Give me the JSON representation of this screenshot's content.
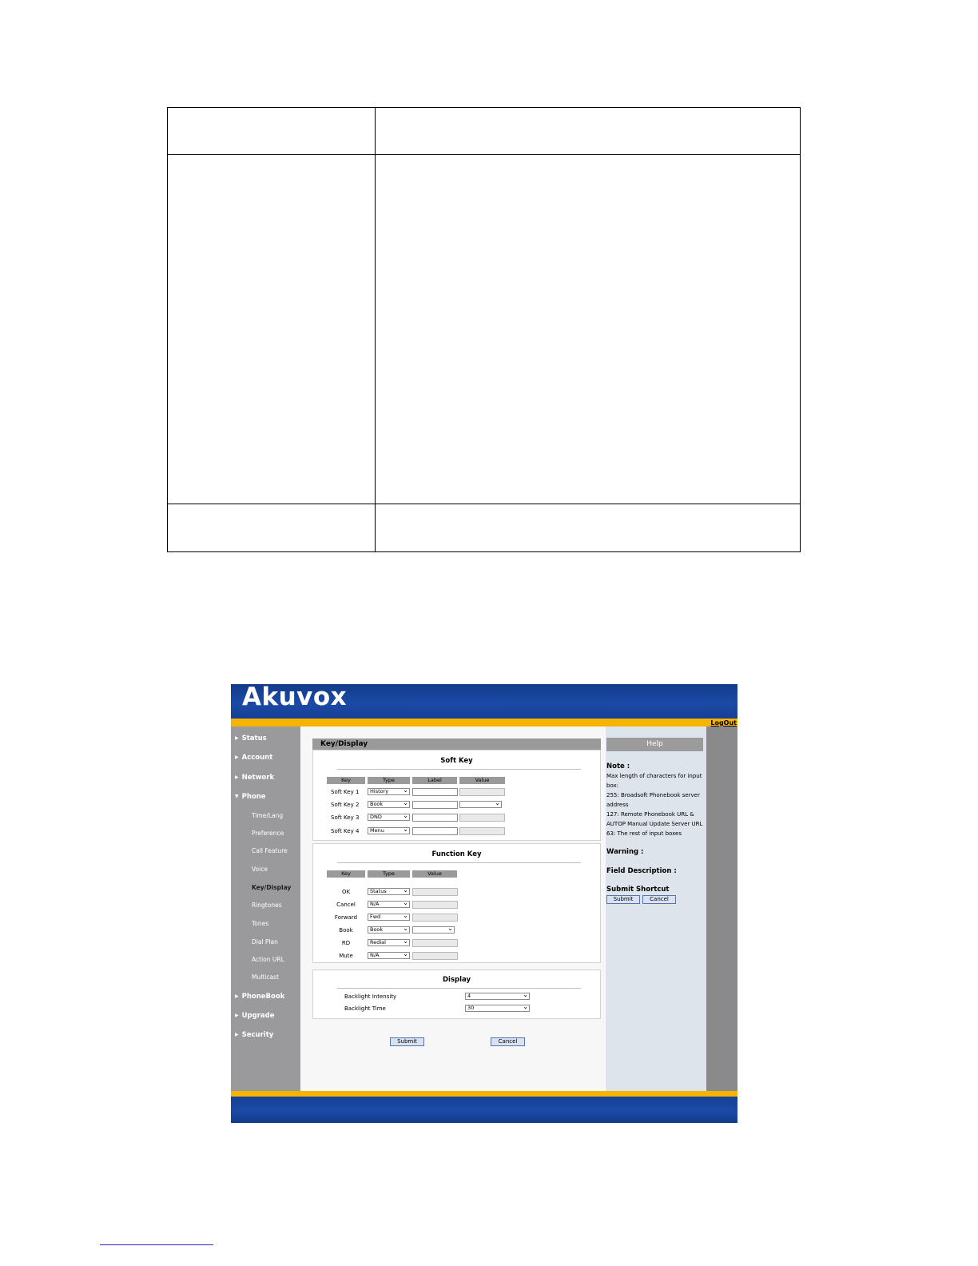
{
  "app": {
    "logo": "Akuvox",
    "logout": "LogOut"
  },
  "sidebar": {
    "items": [
      {
        "label": "Status"
      },
      {
        "label": "Account"
      },
      {
        "label": "Network"
      },
      {
        "label": "Phone"
      },
      {
        "label": "PhoneBook"
      },
      {
        "label": "Upgrade"
      },
      {
        "label": "Security"
      }
    ],
    "phone_sub": [
      "Time/Lang",
      "Preference",
      "Call Feature",
      "Voice",
      "Key/Display",
      "Ringtones",
      "Tones",
      "Dial Plan",
      "Action URL",
      "Multicast"
    ],
    "active": "Key/Display"
  },
  "main": {
    "title": "Key/Display",
    "soft_key": {
      "title": "Soft Key",
      "headers": [
        "Key",
        "Type",
        "Label",
        "Value"
      ],
      "rows": [
        {
          "key": "Soft Key 1",
          "type": "History"
        },
        {
          "key": "Soft Key 2",
          "type": "Book"
        },
        {
          "key": "Soft Key 3",
          "type": "DND"
        },
        {
          "key": "Soft Key 4",
          "type": "Menu"
        }
      ]
    },
    "function_key": {
      "title": "Function Key",
      "headers": [
        "Key",
        "Type",
        "Value"
      ],
      "rows": [
        {
          "key": "OK",
          "type": "Status"
        },
        {
          "key": "Cancel",
          "type": "N/A"
        },
        {
          "key": "Forward",
          "type": "Fwd"
        },
        {
          "key": "Book",
          "type": "Book"
        },
        {
          "key": "RD",
          "type": "Redial"
        },
        {
          "key": "Mute",
          "type": "N/A"
        }
      ]
    },
    "display": {
      "title": "Display",
      "rows": [
        {
          "label": "Backlight Intensity",
          "value": "4"
        },
        {
          "label": "Backlight Time",
          "value": "30"
        }
      ]
    },
    "submit": "Submit",
    "cancel": "Cancel"
  },
  "help": {
    "title": "Help",
    "note_label": "Note :",
    "note_lines": [
      "Max length of characters for input",
      "box:",
      "255: Broadsoft Phonebook server",
      "address",
      "127: Remote Phonebook URL &",
      "AUTOP Manual Update Server URL",
      "63: The rest of input boxes"
    ],
    "warning_label": "Warning :",
    "field_desc_label": "Field Description :",
    "shortcut_label": "Submit Shortcut",
    "submit": "Submit",
    "cancel": "Cancel"
  },
  "colors": {
    "header_blue": "#1b4aa6",
    "accent_yellow": "#f5b400",
    "sidebar_gray": "#9a9a9d"
  }
}
